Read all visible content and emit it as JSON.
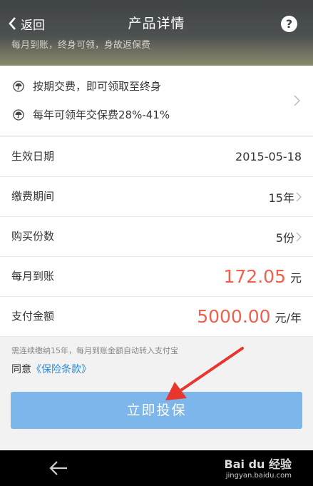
{
  "header": {
    "back_label": "返回",
    "title": "产品详情",
    "help_symbol": "?",
    "banner_text": "每月到账，终身可领，身故返保费"
  },
  "features": [
    {
      "text": "按期交费，即可领取至终身",
      "icon": "umbrella-icon"
    },
    {
      "text": "每年可领年交保费28%-41%",
      "icon": "umbrella-icon"
    }
  ],
  "details": {
    "effective_date": {
      "label": "生效日期",
      "value": "2015-05-18"
    },
    "payment_period": {
      "label": "缴费期间",
      "value": "15年"
    },
    "quantity": {
      "label": "购买份数",
      "value": "5份"
    },
    "monthly": {
      "label": "每月到账",
      "value": "172.05",
      "unit": "元"
    },
    "payment": {
      "label": "支付金额",
      "value": "5000.00",
      "unit": "元/年"
    }
  },
  "note": "需连续缴纳15年，每月到账金额自动转入支付宝",
  "agreement": {
    "prefix": "同意",
    "link": "《保险条款》"
  },
  "submit_label": "立即投保",
  "watermark": {
    "text": "Bai du 经验",
    "url": "jingyan.baidu.com"
  },
  "colors": {
    "accent": "#f0614d",
    "button": "#7db6ea",
    "link": "#2a8ad6",
    "annotation": "#e8352d"
  }
}
